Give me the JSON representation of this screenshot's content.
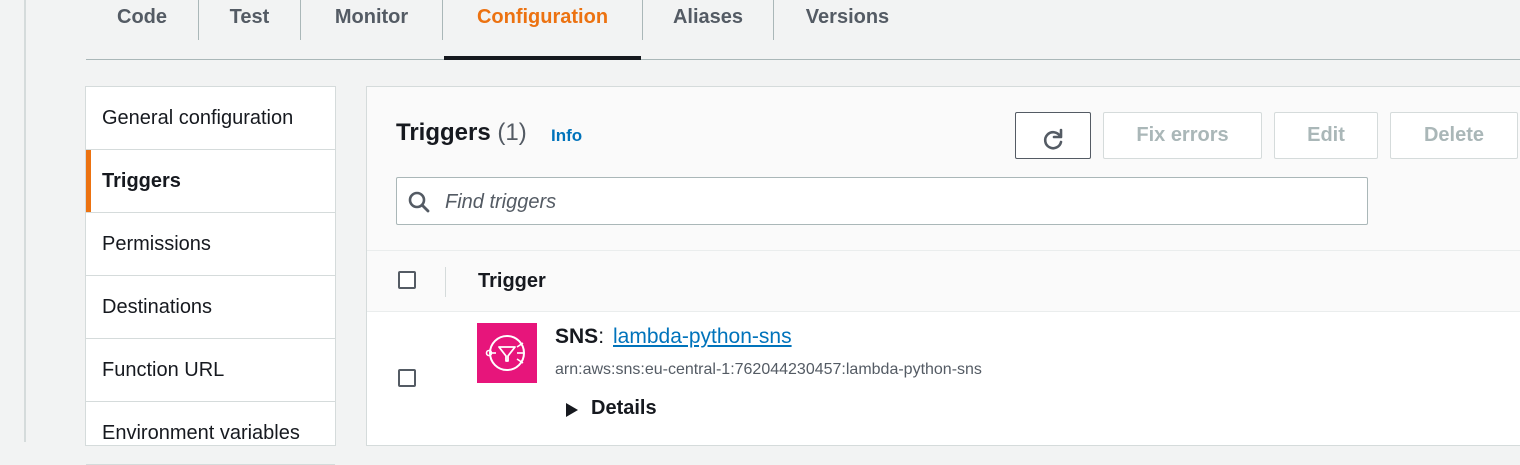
{
  "tabs": [
    {
      "label": "Code"
    },
    {
      "label": "Test"
    },
    {
      "label": "Monitor"
    },
    {
      "label": "Configuration",
      "active": true
    },
    {
      "label": "Aliases"
    },
    {
      "label": "Versions"
    }
  ],
  "sidebar": {
    "items": [
      {
        "label": "General configuration"
      },
      {
        "label": "Triggers",
        "active": true
      },
      {
        "label": "Permissions"
      },
      {
        "label": "Destinations"
      },
      {
        "label": "Function URL"
      },
      {
        "label": "Environment variables"
      }
    ]
  },
  "triggers": {
    "title": "Triggers",
    "count": "(1)",
    "info_link": "Info",
    "buttons": {
      "refresh_icon": "refresh-icon",
      "fix_errors": "Fix errors",
      "edit": "Edit",
      "delete": "Delete"
    },
    "search": {
      "placeholder": "Find triggers",
      "value": ""
    },
    "column_header": "Trigger",
    "rows": [
      {
        "type": "SNS",
        "separator": ":",
        "name": "lambda-python-sns",
        "arn": "arn:aws:sns:eu-central-1:762044230457:lambda-python-sns",
        "details_label": "Details"
      }
    ]
  },
  "colors": {
    "accent": "#ec7211",
    "link": "#0073bb",
    "sns_icon_bg": "#e7157b"
  }
}
